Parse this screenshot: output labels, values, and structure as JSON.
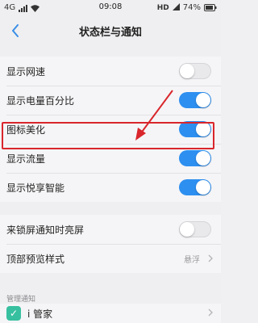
{
  "status_bar": {
    "network_label": "4G",
    "time": "09:08",
    "hd_label": "HD",
    "battery_percent": "74%"
  },
  "title_bar": {
    "title": "状态栏与通知"
  },
  "group1": [
    {
      "label": "显示网速",
      "toggle": "off"
    },
    {
      "label": "显示电量百分比",
      "toggle": "on"
    },
    {
      "label": "图标美化",
      "toggle": "on"
    },
    {
      "label": "显示流量",
      "toggle": "on"
    },
    {
      "label": "显示悦享智能",
      "toggle": "on"
    }
  ],
  "group2": [
    {
      "label": "来锁屏通知时亮屏",
      "toggle": "off"
    },
    {
      "label": "顶部预览样式",
      "value": "悬浮"
    }
  ],
  "section_header": "管理通知",
  "app_row": {
    "name": "i 管家",
    "icon": "shield-check-icon"
  },
  "colors": {
    "accent": "#2d8ff0",
    "highlight": "#d9262c",
    "back_arrow": "#3a8ee6"
  }
}
